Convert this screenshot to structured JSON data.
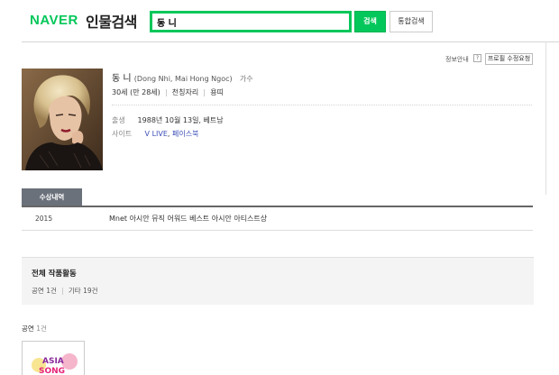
{
  "header": {
    "logo": "NAVER",
    "service": "인물검색",
    "search_value": "동 니",
    "search_button": "검색",
    "total_search_button": "통합검색"
  },
  "profile_tools": {
    "info_link": "정보안내",
    "help": "?",
    "request_edit": "프로필 수정요청"
  },
  "person": {
    "name": "동 니",
    "english_name": "(Dong Nhi, Mai Hong Ngoc)",
    "job": "가수",
    "age": "30세 (만 28세)",
    "zodiac": "천칭자리",
    "animal": "용띠",
    "birth_label": "출생",
    "birth_value": "1988년 10월 13일, 베트남",
    "site_label": "사이트",
    "sites": [
      "V LIVE",
      "페이스북"
    ]
  },
  "awards": {
    "tab_label": "수상내역",
    "items": [
      {
        "year": "2015",
        "title": "Mnet 아시안 뮤직 어워드 베스트 아시안 아티스트상"
      }
    ]
  },
  "works": {
    "title": "전체 작품활동",
    "counts": [
      {
        "label": "공연",
        "count": "1건"
      },
      {
        "label": "기타",
        "count": "19건"
      }
    ]
  },
  "performances": {
    "label": "공연",
    "count": "1건"
  },
  "colors": {
    "naver_green": "#03c75a",
    "link_blue": "#3b4fb8",
    "tab_gray": "#6b717b"
  }
}
